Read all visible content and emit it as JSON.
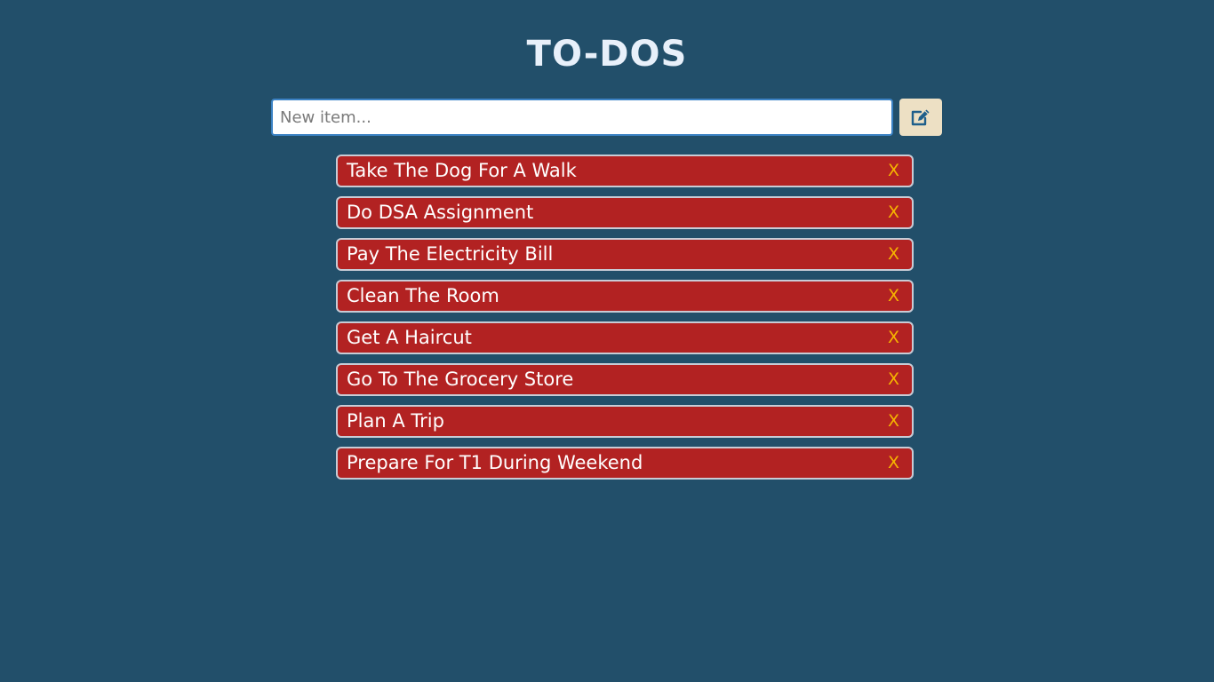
{
  "header": {
    "title": "TO-DOS"
  },
  "new_item": {
    "placeholder": "New item...",
    "value": "",
    "add_button_icon": "edit-icon"
  },
  "colors": {
    "background": "#224f6a",
    "item_background": "#b22222",
    "delete_color": "#f5b400",
    "add_button": "#ede0c4"
  },
  "todos": [
    {
      "text": "Take The Dog For A Walk",
      "delete_label": "X"
    },
    {
      "text": "Do DSA Assignment",
      "delete_label": "X"
    },
    {
      "text": "Pay The Electricity Bill",
      "delete_label": "X"
    },
    {
      "text": "Clean The Room",
      "delete_label": "X"
    },
    {
      "text": "Get A Haircut",
      "delete_label": "X"
    },
    {
      "text": "Go To The Grocery Store",
      "delete_label": "X"
    },
    {
      "text": "Plan A Trip",
      "delete_label": "X"
    },
    {
      "text": "Prepare For T1 During Weekend",
      "delete_label": "X"
    }
  ]
}
